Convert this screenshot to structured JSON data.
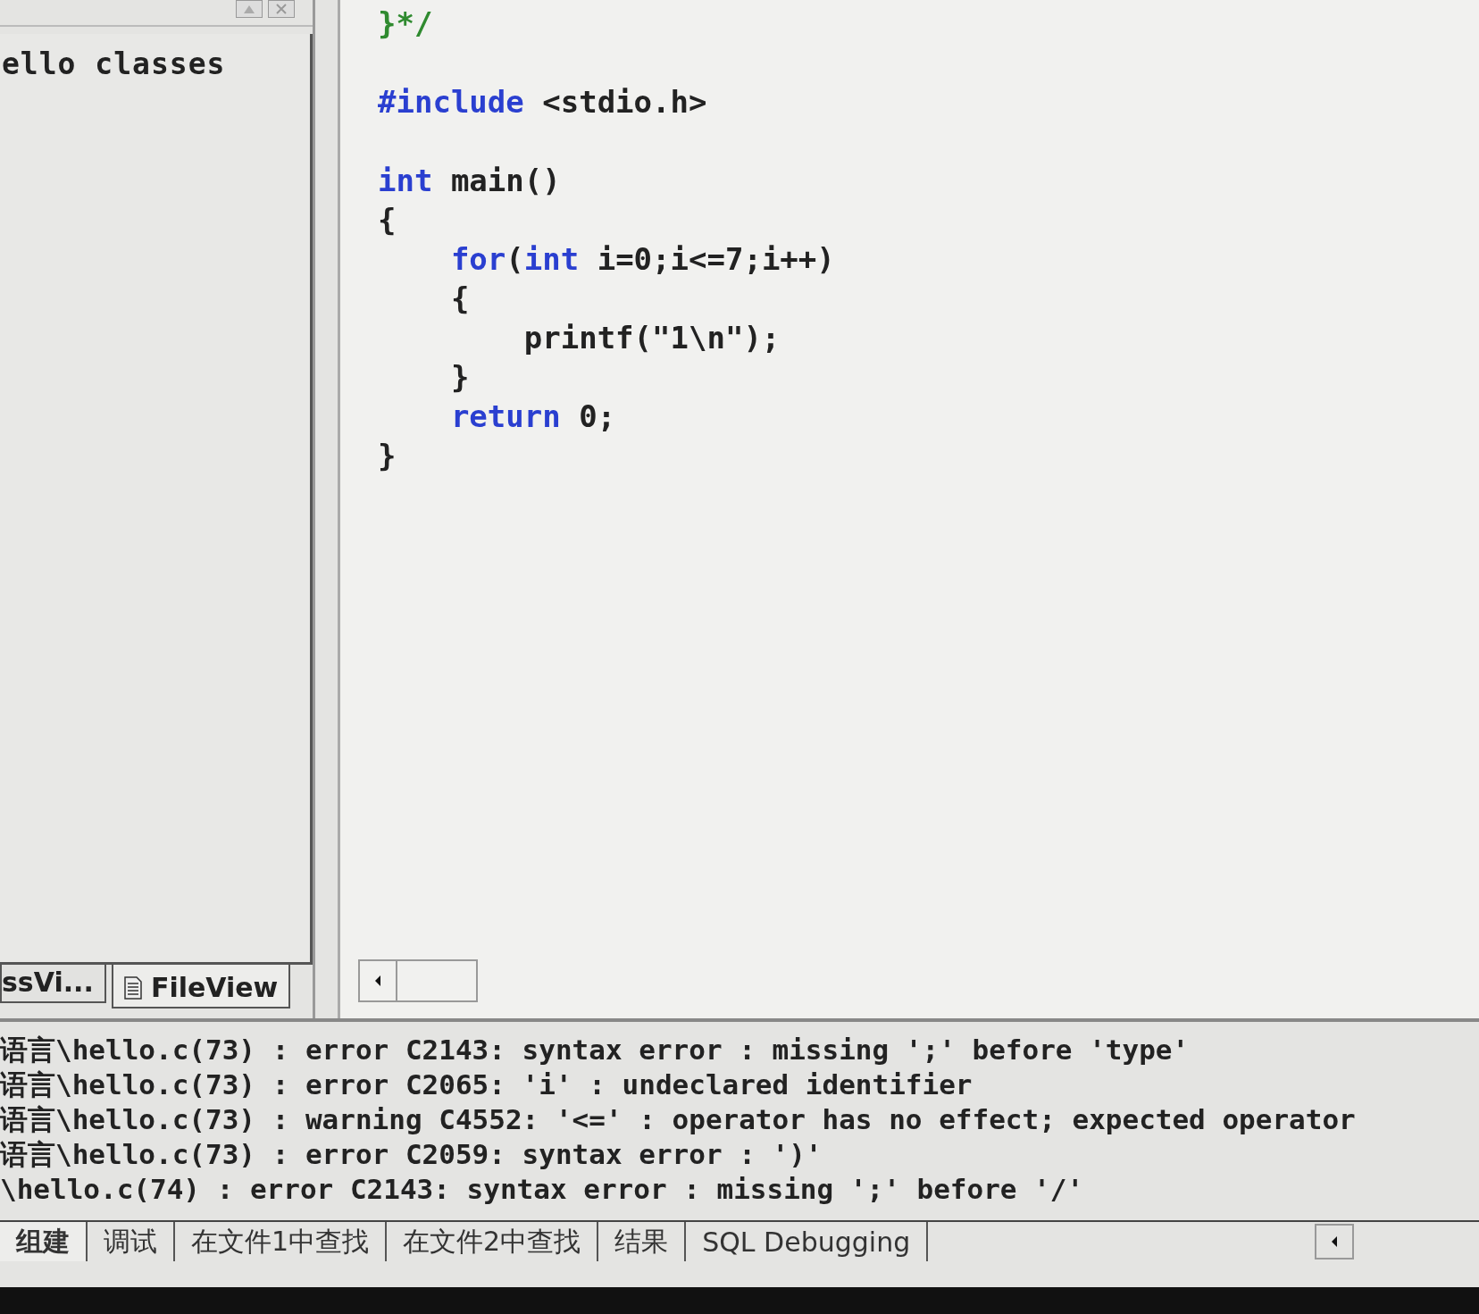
{
  "workspace": {
    "tree_root": "ello classes",
    "tabs": [
      {
        "label": "ssVi...",
        "selected": false,
        "icon": false
      },
      {
        "label": "FileView",
        "selected": true,
        "icon": true
      }
    ]
  },
  "editor": {
    "lines": [
      {
        "kind": "code",
        "tokens": [
          {
            "kind": "comment",
            "text": "}*/"
          }
        ]
      },
      {
        "kind": "blank"
      },
      {
        "kind": "code",
        "tokens": [
          {
            "kind": "keyword",
            "text": "#include"
          },
          {
            "kind": "plain",
            "text": " <stdio.h>"
          }
        ]
      },
      {
        "kind": "blank"
      },
      {
        "kind": "code",
        "tokens": [
          {
            "kind": "keyword",
            "text": "int"
          },
          {
            "kind": "plain",
            "text": " main()"
          }
        ]
      },
      {
        "kind": "code",
        "tokens": [
          {
            "kind": "plain",
            "text": "{"
          }
        ]
      },
      {
        "kind": "code",
        "tokens": [
          {
            "kind": "keyword",
            "text": "    for"
          },
          {
            "kind": "plain",
            "text": "("
          },
          {
            "kind": "keyword",
            "text": "int"
          },
          {
            "kind": "plain",
            "text": " i=0;i<=7;i++)"
          }
        ]
      },
      {
        "kind": "code",
        "tokens": [
          {
            "kind": "plain",
            "text": "    {"
          }
        ]
      },
      {
        "kind": "code",
        "tokens": [
          {
            "kind": "plain",
            "text": "        printf(\"1\\n\");"
          }
        ]
      },
      {
        "kind": "code",
        "tokens": [
          {
            "kind": "plain",
            "text": "    }"
          }
        ]
      },
      {
        "kind": "code",
        "tokens": [
          {
            "kind": "keyword",
            "text": "    return"
          },
          {
            "kind": "plain",
            "text": " 0;"
          }
        ]
      },
      {
        "kind": "code",
        "tokens": [
          {
            "kind": "plain",
            "text": "}"
          }
        ]
      }
    ]
  },
  "output": {
    "lines": [
      "语言\\hello.c(73) : error C2143: syntax error : missing ';' before 'type'",
      "语言\\hello.c(73) : error C2065: 'i' : undeclared identifier",
      "语言\\hello.c(73) : warning C4552: '<=' : operator has no effect; expected operator",
      "语言\\hello.c(73) : error C2059: syntax error : ')'",
      "\\hello.c(74) : error C2143: syntax error : missing ';' before '/'"
    ],
    "tabs": [
      {
        "label": "组建",
        "selected": true
      },
      {
        "label": "调试",
        "selected": false
      },
      {
        "label": "在文件1中查找",
        "selected": false
      },
      {
        "label": "在文件2中查找",
        "selected": false
      },
      {
        "label": "结果",
        "selected": false
      },
      {
        "label": "SQL Debugging",
        "selected": false
      }
    ]
  }
}
